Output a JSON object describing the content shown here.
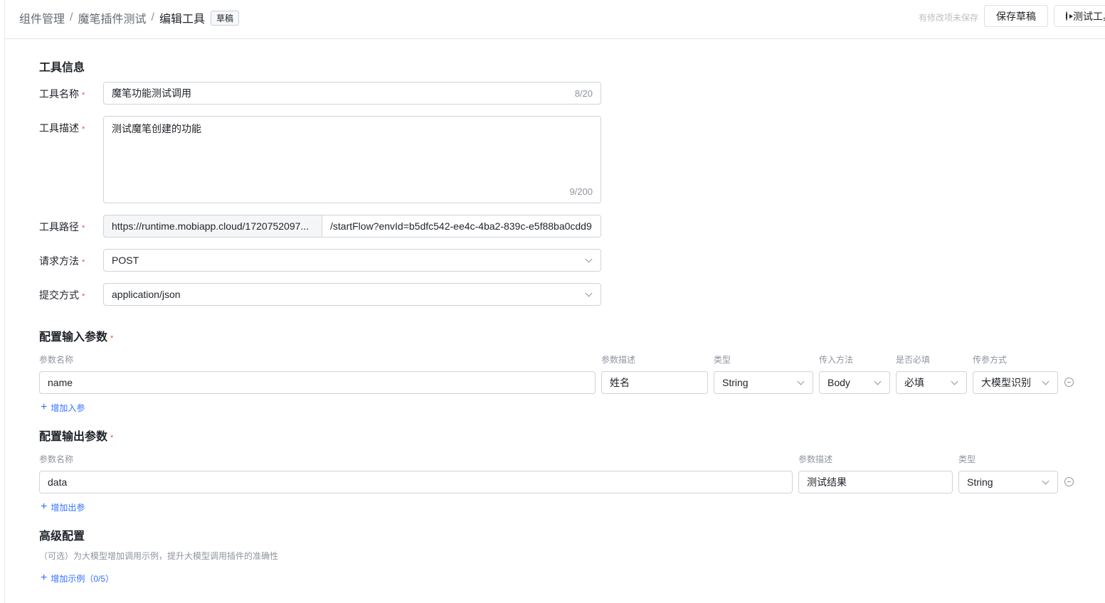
{
  "header": {
    "breadcrumb": [
      "组件管理",
      "魔笔插件测试",
      "编辑工具"
    ],
    "status_badge": "草稿",
    "unsaved": "有修改项未保存",
    "save_draft": "保存草稿",
    "test_tool": "测试工具"
  },
  "tool_info": {
    "title": "工具信息",
    "name": {
      "label": "工具名称",
      "value": "魔笔功能测试调用",
      "count": "8/20"
    },
    "desc": {
      "label": "工具描述",
      "value": "测试魔笔创建的功能",
      "count": "9/200"
    },
    "path": {
      "label": "工具路径",
      "base": "https://runtime.mobiapp.cloud/1720752097...",
      "suffix": "/startFlow?envId=b5dfc542-ee4c-4ba2-839c-e5f88ba0cdd9"
    },
    "method": {
      "label": "请求方法",
      "value": "POST"
    },
    "submit": {
      "label": "提交方式",
      "value": "application/json"
    }
  },
  "input_params": {
    "title": "配置输入参数",
    "headers": [
      "参数名称",
      "参数描述",
      "类型",
      "传入方法",
      "是否必填",
      "传参方式"
    ],
    "rows": [
      {
        "name": "name",
        "desc": "姓名",
        "type": "String",
        "method": "Body",
        "required": "必填",
        "mode": "大模型识别"
      }
    ],
    "add": "增加入参"
  },
  "output_params": {
    "title": "配置输出参数",
    "headers": [
      "参数名称",
      "参数描述",
      "类型"
    ],
    "rows": [
      {
        "name": "data",
        "desc": "测试结果",
        "type": "String"
      }
    ],
    "add": "增加出参"
  },
  "advanced": {
    "title": "高级配置",
    "hint": "（可选）为大模型增加调用示例，提升大模型调用插件的准确性",
    "add": "增加示例（0/5）"
  },
  "required_mark": "*"
}
